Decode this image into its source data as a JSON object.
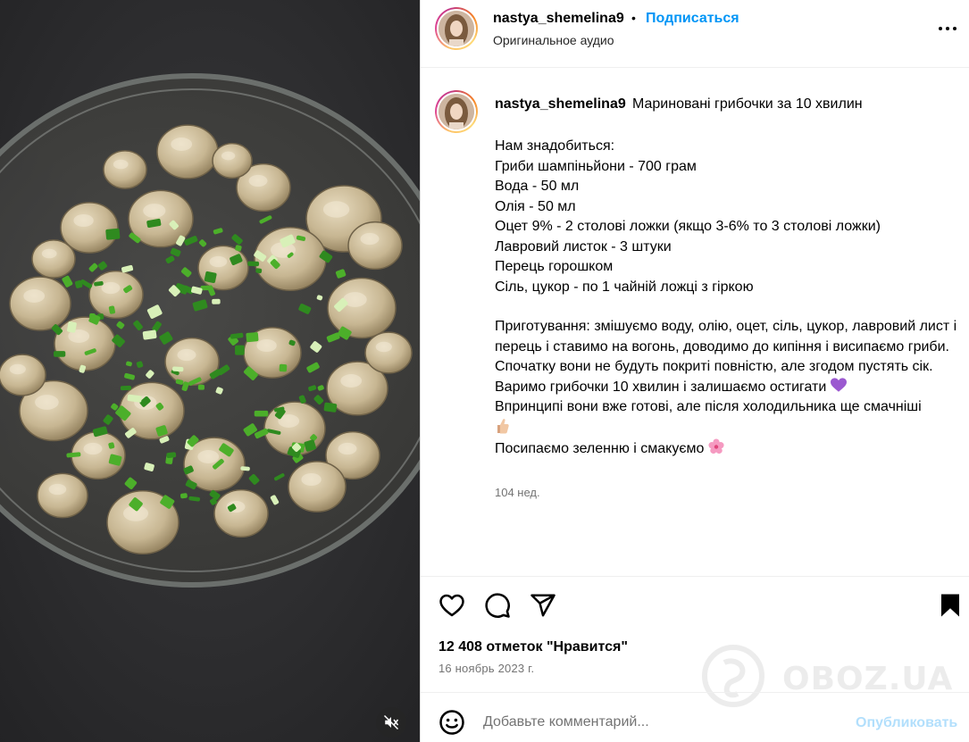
{
  "post": {
    "username": "nastya_shemelina9",
    "separator": "•",
    "follow_label": "Подписаться",
    "audio_label": "Оригинальное аудио"
  },
  "caption": {
    "username": "nastya_shemelina9",
    "title": "Мариновані грибочки за 10 хвилин",
    "lines": [
      "Нам знадобиться:",
      "Гриби шампіньйони - 700 грам",
      "Вода - 50 мл",
      "Олія - 50 мл",
      "Оцет 9% - 2 столові ложки (якщо 3-6% то 3 столові ложки)",
      "Лавровий листок - 3 штуки",
      "Перець горошком",
      "Сіль, цукор - по 1 чайній ложці з гіркою"
    ],
    "method": "Приготування: змішуємо воду, олію, оцет, сіль, цукор, лавровий лист і перець і ставимо на вогонь, доводимо до кипіння і висипаємо гриби. Спочатку вони не будуть покриті повністю, але згодом пустять сік. Варимо грибочки 10 хвилин і залишаємо остигати",
    "note": "Впринципі вони вже готові, але після холодильника ще смачніші",
    "final": "Посипаємо зеленню і смакуємо",
    "time": "104 нед."
  },
  "actions": {
    "icons": [
      "heart-icon",
      "comment-icon",
      "share-icon",
      "bookmark-icon"
    ]
  },
  "likes_text": "12 408 отметок \"Нравится\"",
  "date_text": "16 ноябрь 2023 г.",
  "comment": {
    "placeholder": "Добавьте комментарий...",
    "post_label": "Опубликовать"
  },
  "watermark": "OBOZ.UA",
  "colors": {
    "accent": "#0095f6",
    "post_disabled": "#b2dffc",
    "muted": "#737373"
  }
}
